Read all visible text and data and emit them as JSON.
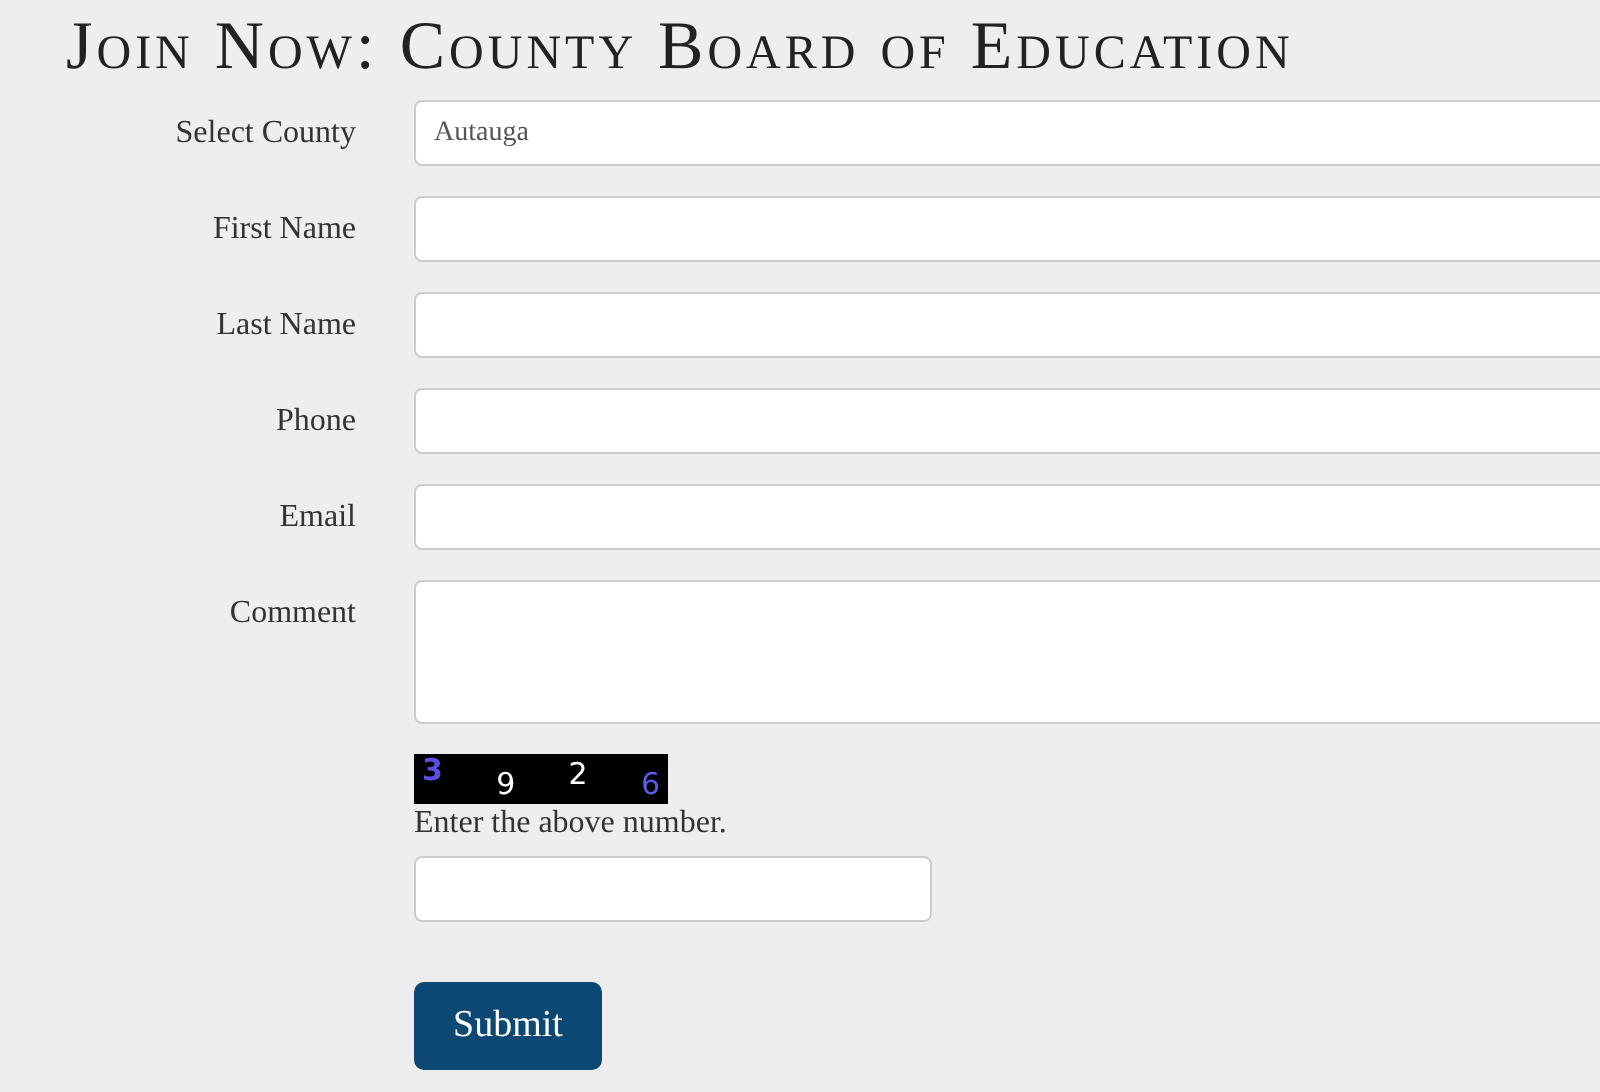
{
  "title": "Join Now: County Board of Education",
  "fields": [
    {
      "label": "Select County",
      "kind": "select",
      "value": "Autauga"
    },
    {
      "label": "First Name",
      "kind": "text"
    },
    {
      "label": "Last Name",
      "kind": "text"
    },
    {
      "label": "Phone",
      "kind": "text"
    },
    {
      "label": "Email",
      "kind": "text"
    },
    {
      "label": "Comment",
      "kind": "textarea"
    }
  ],
  "captcha": {
    "digits": [
      {
        "text": "3",
        "color": "#5a4fe0"
      },
      {
        "text": "9",
        "color": "#ffffff"
      },
      {
        "text": "2",
        "color": "#ffffff"
      },
      {
        "text": "6",
        "color": "#5a5ae8"
      }
    ],
    "prompt": "Enter the above number."
  },
  "submit": "Submit"
}
